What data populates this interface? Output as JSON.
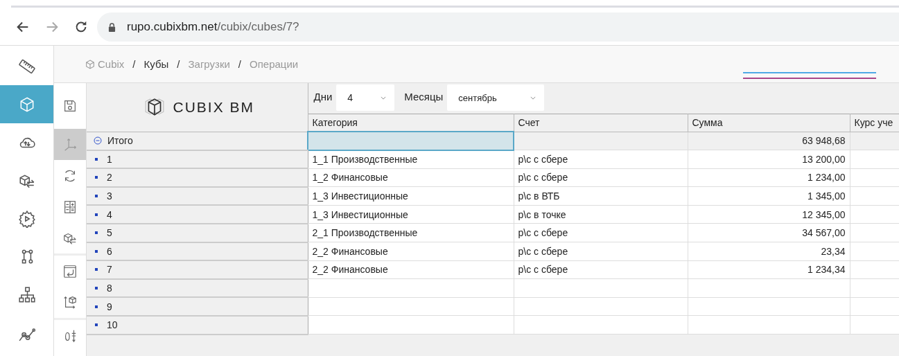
{
  "browser": {
    "url_host": "rupo.cubixbm.net",
    "url_path": "/cubix/cubes/7?"
  },
  "sidebar": {
    "items": [
      {
        "selected": false
      },
      {
        "selected": true
      },
      {
        "selected": false
      },
      {
        "selected": false
      },
      {
        "selected": false
      },
      {
        "selected": false
      },
      {
        "selected": false
      },
      {
        "selected": false
      }
    ]
  },
  "breadcrumb": [
    {
      "label": "Cubix",
      "current": false
    },
    {
      "separator": "/",
      "label": "Кубы",
      "current": true
    },
    {
      "separator": "/",
      "label": "Загрузки",
      "current": false
    },
    {
      "separator": "/",
      "label": "Операции",
      "current": false
    }
  ],
  "tools": [
    {
      "selected": false
    },
    {
      "selected": true
    },
    {
      "selected": false
    },
    {
      "selected": false
    },
    {
      "selected": false
    },
    {
      "selected": false
    },
    {
      "selected": false
    },
    {
      "selected": false
    }
  ],
  "logo": "CUBIX BM",
  "filters": [
    {
      "label": "Дни",
      "value": "4"
    },
    {
      "label": "Месяцы",
      "value": "сентябрь"
    }
  ],
  "columns": [
    "Категория",
    "Счет",
    "Сумма",
    "Курс уче"
  ],
  "total": {
    "label": "Итого",
    "expanded": true,
    "selected": true,
    "sum": "63 948,68"
  },
  "rows": [
    {
      "label": "1",
      "category": "1_1 Производственные",
      "account": "р\\с с сбере",
      "sum": "13 200,00"
    },
    {
      "label": "2",
      "category": "1_2 Финансовые",
      "account": "р\\с с сбере",
      "sum": "1 234,00"
    },
    {
      "label": "3",
      "category": "1_3 Инвестиционные",
      "account": "р\\с в ВТБ",
      "sum": "1 345,00"
    },
    {
      "label": "4",
      "category": "1_3 Инвестиционные",
      "account": "р\\с в точке",
      "sum": "12 345,00"
    },
    {
      "label": "5",
      "category": "2_1 Производственные",
      "account": "р\\с с сбере",
      "sum": "34 567,00"
    },
    {
      "label": "6",
      "category": "2_2 Финансовые",
      "account": "р\\с с сбере",
      "sum": "23,34"
    },
    {
      "label": "7",
      "category": "2_2 Финансовые",
      "account": "р\\с с сбере",
      "sum": "1 234,34"
    },
    {
      "label": "8"
    },
    {
      "label": "9"
    },
    {
      "label": "10"
    }
  ]
}
